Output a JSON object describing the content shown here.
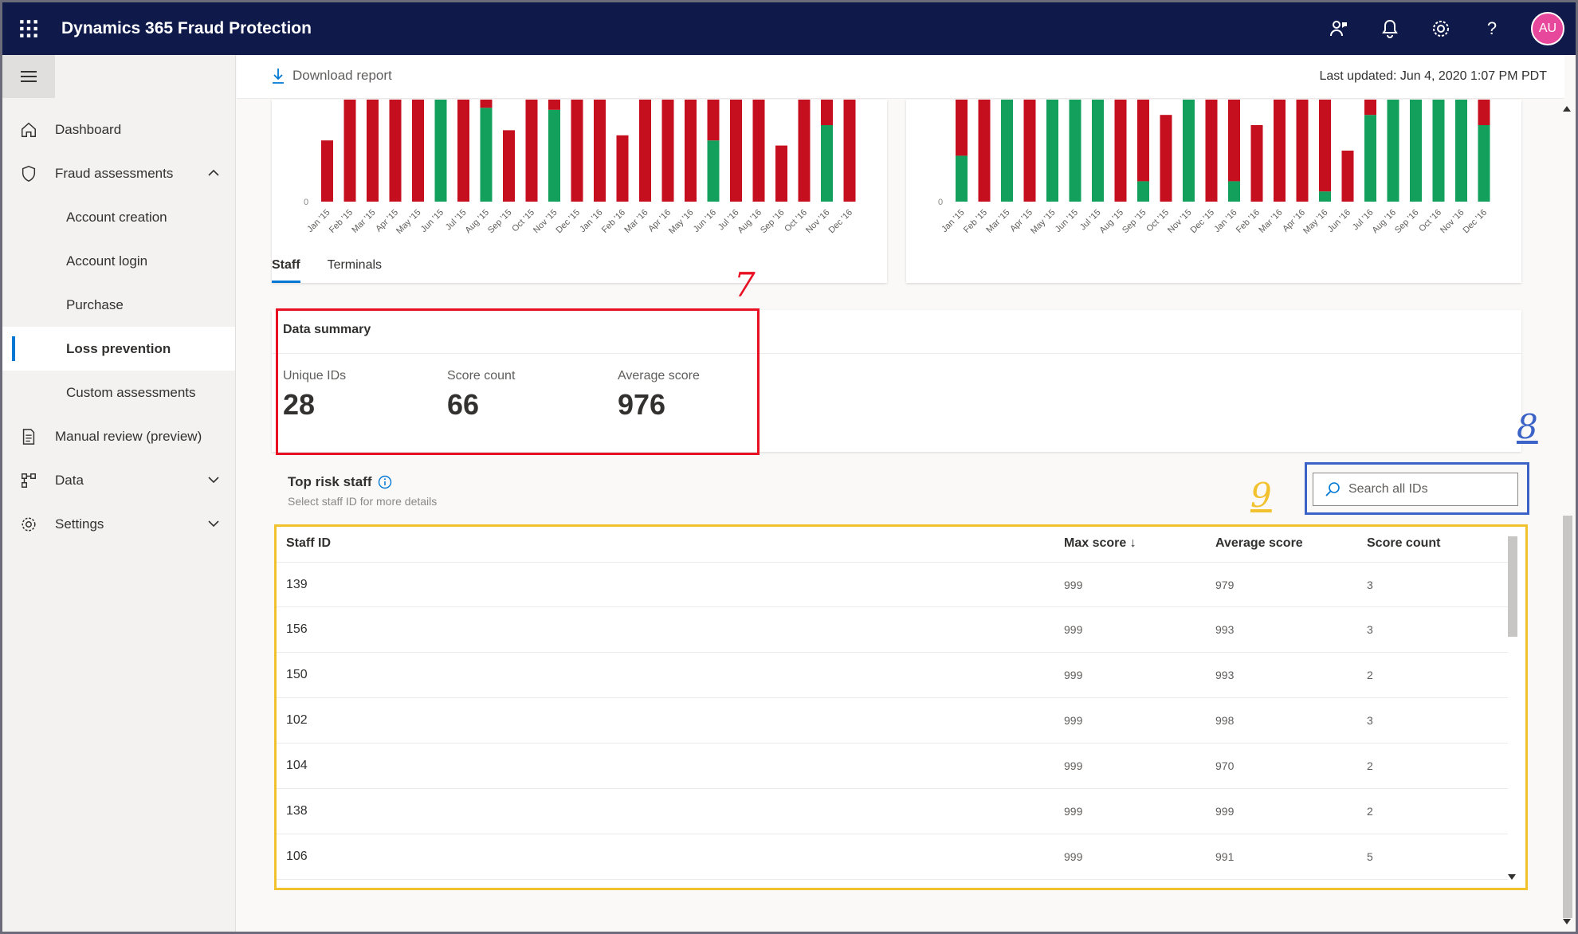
{
  "app": {
    "title": "Dynamics 365 Fraud Protection",
    "avatar_initials": "AU",
    "accent": "#0078d4",
    "topbar_color": "#0f1a4a",
    "icons": [
      "waffle-icon",
      "person-feedback-icon",
      "bell-icon",
      "gear-icon",
      "help-icon"
    ]
  },
  "sidebar": {
    "items": [
      {
        "label": "Dashboard",
        "icon": "home-icon"
      },
      {
        "label": "Fraud assessments",
        "icon": "shield-icon",
        "expanded": true
      },
      {
        "label": "Account creation"
      },
      {
        "label": "Account login"
      },
      {
        "label": "Purchase"
      },
      {
        "label": "Loss prevention",
        "active": true
      },
      {
        "label": "Custom assessments"
      },
      {
        "label": "Manual review (preview)",
        "icon": "document-icon"
      },
      {
        "label": "Data",
        "icon": "flowchart-icon"
      },
      {
        "label": "Settings",
        "icon": "settings-icon"
      }
    ]
  },
  "commandbar": {
    "download_label": "Download report",
    "last_updated": "Last updated: Jun 4, 2020 1:07 PM PDT"
  },
  "chart_data": [
    {
      "type": "bar",
      "stacked": true,
      "categories": [
        "Jan '15",
        "Feb '15",
        "Mar '15",
        "Apr '15",
        "May '15",
        "Jun '15",
        "Jul '15",
        "Aug '15",
        "Sep '15",
        "Oct '15",
        "Nov '15",
        "Dec '15",
        "Jan '16",
        "Feb '16",
        "Mar '16",
        "Apr '16",
        "May '16",
        "Jun '16",
        "Jul '16",
        "Aug '16",
        "Sep '16",
        "Oct '16",
        "Nov '16",
        "Dec '16"
      ],
      "y_zero_label": "0",
      "series": [
        {
          "color": "#12a05c",
          "values": [
            0,
            0,
            0,
            0,
            0,
            1,
            0,
            0.92,
            0,
            0,
            0.9,
            0,
            0,
            0,
            0,
            0,
            0,
            0.6,
            0,
            0,
            0,
            0,
            0.75,
            0
          ]
        },
        {
          "color": "#c50f1f",
          "values": [
            0.6,
            1,
            1,
            1,
            1,
            0,
            1,
            0.08,
            0.7,
            1,
            0.1,
            1,
            1,
            0.65,
            1,
            1,
            1,
            0.4,
            1,
            1,
            0.55,
            1,
            0.25,
            1
          ]
        }
      ]
    },
    {
      "type": "bar",
      "stacked": true,
      "categories": [
        "Jan '15",
        "Feb '15",
        "Mar '15",
        "Apr '15",
        "May '15",
        "Jun '15",
        "Jul '15",
        "Aug '15",
        "Sep '15",
        "Oct '15",
        "Nov '15",
        "Dec '15",
        "Jan '16",
        "Feb '16",
        "Mar '16",
        "Apr '16",
        "May '16",
        "Jun '16",
        "Jul '16",
        "Aug '16",
        "Sep '16",
        "Oct '16",
        "Nov '16",
        "Dec '16"
      ],
      "y_zero_label": "0",
      "series": [
        {
          "color": "#12a05c",
          "values": [
            0.45,
            0,
            1,
            0,
            1,
            1,
            1,
            0,
            0.2,
            0,
            1,
            0,
            0.2,
            0,
            0,
            0,
            0.1,
            0,
            0.85,
            1,
            1,
            1,
            1,
            0.75
          ]
        },
        {
          "color": "#c50f1f",
          "values": [
            0.55,
            1,
            0,
            1,
            0,
            0,
            0,
            1,
            0.8,
            0.85,
            0,
            1,
            0.8,
            0.75,
            1,
            1,
            0.9,
            0.5,
            0.15,
            0,
            0,
            0,
            0,
            0.25
          ]
        }
      ]
    }
  ],
  "tabs": [
    {
      "label": "Staff",
      "active": true
    },
    {
      "label": "Terminals"
    }
  ],
  "summary": {
    "title": "Data summary",
    "metrics": [
      {
        "label": "Unique IDs",
        "value": "28"
      },
      {
        "label": "Score count",
        "value": "66"
      },
      {
        "label": "Average score",
        "value": "976"
      }
    ]
  },
  "annotations": {
    "seven": "7",
    "eight": "8",
    "nine": "9"
  },
  "top_risk": {
    "title": "Top risk staff",
    "subtitle": "Select staff ID for more details",
    "search_placeholder": "Search all IDs",
    "columns": [
      "Staff ID",
      "Max score ↓",
      "Average score",
      "Score count"
    ],
    "rows": [
      {
        "id": "139",
        "max": "999",
        "avg": "979",
        "count": "3"
      },
      {
        "id": "156",
        "max": "999",
        "avg": "993",
        "count": "3"
      },
      {
        "id": "150",
        "max": "999",
        "avg": "993",
        "count": "2"
      },
      {
        "id": "102",
        "max": "999",
        "avg": "998",
        "count": "3"
      },
      {
        "id": "104",
        "max": "999",
        "avg": "970",
        "count": "2"
      },
      {
        "id": "138",
        "max": "999",
        "avg": "999",
        "count": "2"
      },
      {
        "id": "106",
        "max": "999",
        "avg": "991",
        "count": "5"
      }
    ]
  }
}
